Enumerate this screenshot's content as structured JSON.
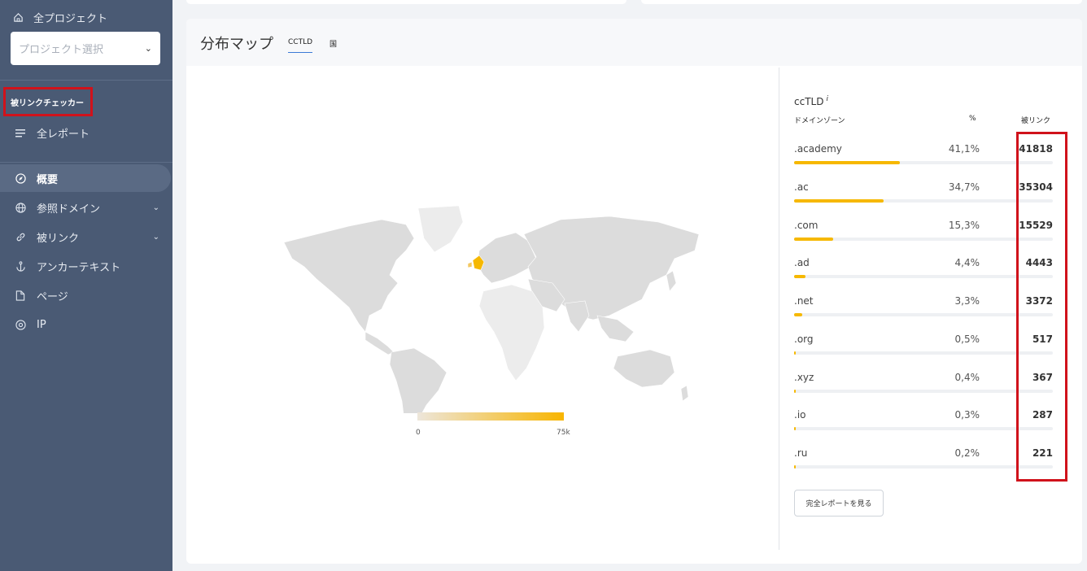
{
  "sidebar": {
    "all_projects": "全プロジェクト",
    "project_select_placeholder": "プロジェクト選択",
    "section_label": "被リンクチェッカー",
    "all_reports": "全レポート",
    "items": [
      {
        "label": "概要",
        "icon": "compass-icon",
        "active": true
      },
      {
        "label": "参照ドメイン",
        "icon": "globe-icon",
        "has_children": true
      },
      {
        "label": "被リンク",
        "icon": "link-icon",
        "has_children": true
      },
      {
        "label": "アンカーテキスト",
        "icon": "anchor-icon"
      },
      {
        "label": "ページ",
        "icon": "page-icon"
      },
      {
        "label": "IP",
        "icon": "target-icon"
      }
    ]
  },
  "card": {
    "title": "分布マップ",
    "tabs": [
      {
        "label": "CCTLD",
        "active": true
      },
      {
        "label": "国",
        "active": false
      }
    ]
  },
  "legend": {
    "min": "0",
    "max": "75k"
  },
  "table": {
    "title": "ccTLD",
    "info": "i",
    "headers": {
      "zone": "ドメインゾーン",
      "pct": "%",
      "links": "被リンク"
    },
    "rows": [
      {
        "domain": ".academy",
        "pct": "41,1%",
        "links": "41818",
        "fraction": 0.411
      },
      {
        "domain": ".ac",
        "pct": "34,7%",
        "links": "35304",
        "fraction": 0.347
      },
      {
        "domain": ".com",
        "pct": "15,3%",
        "links": "15529",
        "fraction": 0.153
      },
      {
        "domain": ".ad",
        "pct": "4,4%",
        "links": "4443",
        "fraction": 0.044
      },
      {
        "domain": ".net",
        "pct": "3,3%",
        "links": "3372",
        "fraction": 0.033
      },
      {
        "domain": ".org",
        "pct": "0,5%",
        "links": "517",
        "fraction": 0.005
      },
      {
        "domain": ".xyz",
        "pct": "0,4%",
        "links": "367",
        "fraction": 0.004
      },
      {
        "domain": ".io",
        "pct": "0,3%",
        "links": "287",
        "fraction": 0.003
      },
      {
        "domain": ".ru",
        "pct": "0,2%",
        "links": "221",
        "fraction": 0.002
      }
    ],
    "full_report_button": "完全レポートを見る"
  },
  "colors": {
    "sidebar": "#4a5a74",
    "accent": "#f6b800",
    "highlight": "#d0121b"
  }
}
